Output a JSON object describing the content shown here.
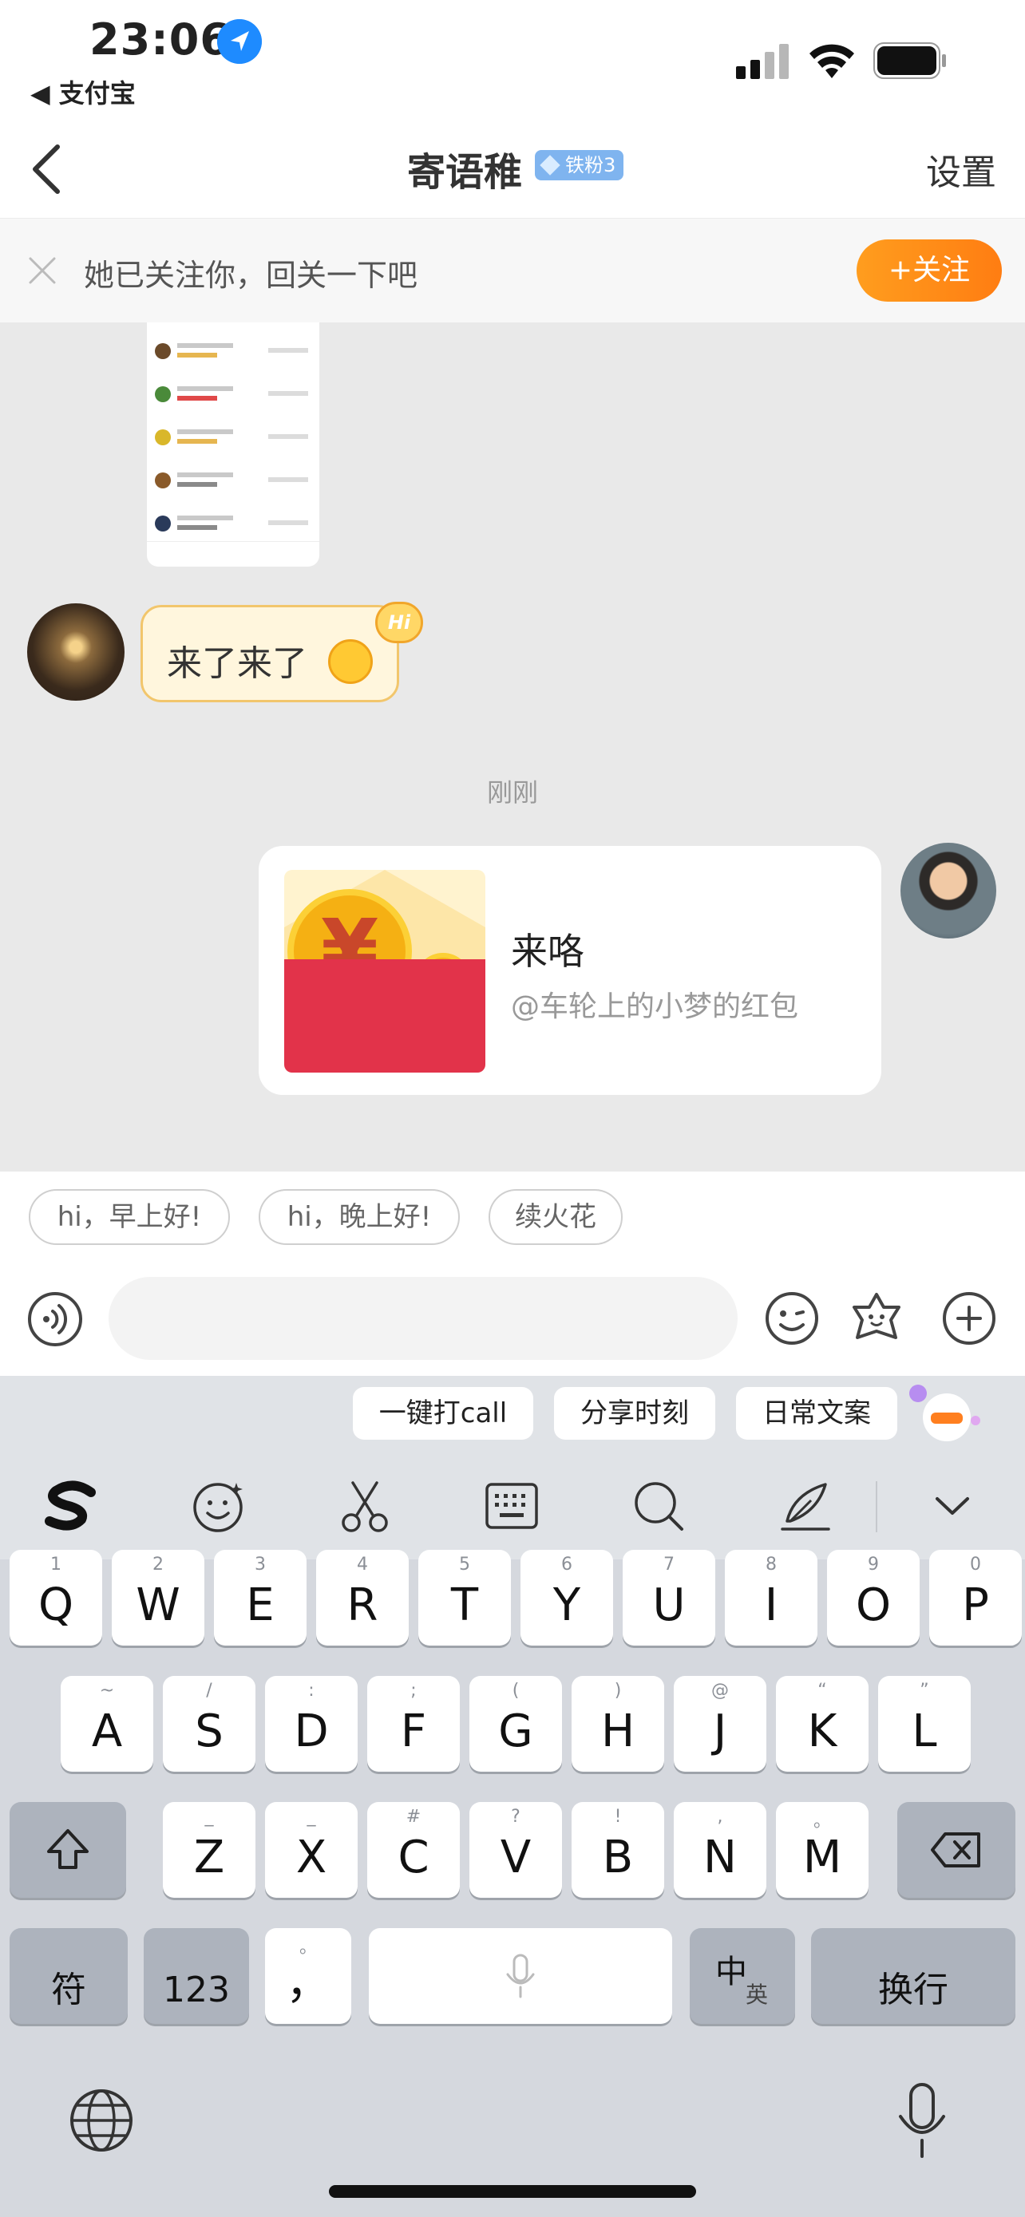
{
  "status_bar": {
    "time": "23:06",
    "back_app": "◀ 支付宝"
  },
  "nav": {
    "title": "寄语稚",
    "fan_badge": "铁粉3",
    "settings": "设置"
  },
  "follow_bar": {
    "text": "她已关注你，回关一下吧",
    "button": "+关注"
  },
  "messages": {
    "incoming_text": "来了来了",
    "hi_badge": "Hi",
    "timestamp": "刚刚",
    "red_packet_title": "来咯",
    "red_packet_sub": "@车轮上的小梦的红包"
  },
  "quick_replies": [
    "hi，早上好!",
    "hi，晚上好!",
    "续火花"
  ],
  "input": {
    "placeholder": ""
  },
  "keyboard": {
    "suggestions": [
      "一键打call",
      "分享时刻",
      "日常文案"
    ],
    "row1": [
      {
        "k": "Q",
        "h": "1"
      },
      {
        "k": "W",
        "h": "2"
      },
      {
        "k": "E",
        "h": "3"
      },
      {
        "k": "R",
        "h": "4"
      },
      {
        "k": "T",
        "h": "5"
      },
      {
        "k": "Y",
        "h": "6"
      },
      {
        "k": "U",
        "h": "7"
      },
      {
        "k": "I",
        "h": "8"
      },
      {
        "k": "O",
        "h": "9"
      },
      {
        "k": "P",
        "h": "0"
      }
    ],
    "row2": [
      {
        "k": "A",
        "h": "~"
      },
      {
        "k": "S",
        "h": "/"
      },
      {
        "k": "D",
        "h": ":"
      },
      {
        "k": "F",
        "h": ";"
      },
      {
        "k": "G",
        "h": "("
      },
      {
        "k": "H",
        "h": ")"
      },
      {
        "k": "J",
        "h": "@"
      },
      {
        "k": "K",
        "h": "“"
      },
      {
        "k": "L",
        "h": "”"
      }
    ],
    "row3": [
      {
        "k": "Z",
        "h": "_"
      },
      {
        "k": "X",
        "h": "_"
      },
      {
        "k": "C",
        "h": "#"
      },
      {
        "k": "V",
        "h": "?"
      },
      {
        "k": "B",
        "h": "!"
      },
      {
        "k": "N",
        "h": ","
      },
      {
        "k": "M",
        "h": "。"
      }
    ],
    "symbol_key": "符",
    "number_key": "123",
    "punct_key": "，",
    "punct_hint": "。",
    "lang_key": "中",
    "lang_sub": "英",
    "return_key": "换行"
  }
}
